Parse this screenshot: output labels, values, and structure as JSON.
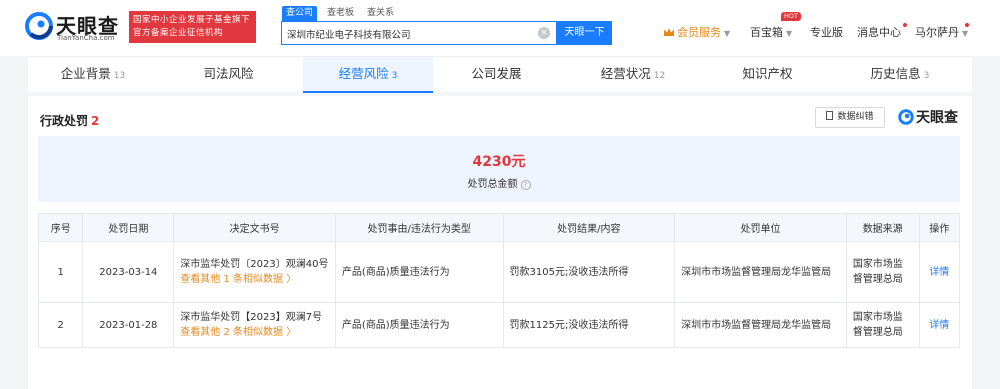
{
  "brand": {
    "logo_text": "天眼查",
    "logo_url": "TianYanCha.com",
    "slogan_line1": "国家中小企业发展子基金旗下",
    "slogan_line2": "官方备案企业征信机构"
  },
  "search": {
    "tabs": [
      "查公司",
      "查老板",
      "查关系"
    ],
    "value": "深圳市纪业电子科技有限公司",
    "button_label": "天眼一下"
  },
  "header_nav": {
    "vip_label": "会员服务",
    "treasure_label": "百宝箱",
    "hot_badge": "HOT",
    "pro_label": "专业版",
    "messages_label": "消息中心",
    "user_name": "马尔萨丹"
  },
  "tabs": [
    {
      "label": "企业背景",
      "count": "13"
    },
    {
      "label": "司法风险",
      "count": ""
    },
    {
      "label": "经营风险",
      "count": "3"
    },
    {
      "label": "公司发展",
      "count": ""
    },
    {
      "label": "经营状况",
      "count": "12"
    },
    {
      "label": "知识产权",
      "count": ""
    },
    {
      "label": "历史信息",
      "count": "3"
    }
  ],
  "section": {
    "title": "行政处罚",
    "count": "2",
    "correct_button": "数据纠错",
    "brand_text": "天眼查"
  },
  "summary": {
    "amount": "4230元",
    "label": "处罚总金额"
  },
  "table": {
    "headers": [
      "序号",
      "处罚日期",
      "决定文书号",
      "处罚事由/违法行为类型",
      "处罚结果/内容",
      "处罚单位",
      "数据来源",
      "操作"
    ],
    "rows": [
      {
        "index": "1",
        "date": "2023-03-14",
        "doc_no": "深市监华处罚〔2023〕观澜40号",
        "more": "查看其他 1 条相似数据 〉",
        "reason": "产品(商品)质量违法行为",
        "result": "罚款3105元;没收违法所得",
        "unit": "深圳市市场监督管理局龙华监管局",
        "source": "国家市场监督管理总局",
        "action": "详情"
      },
      {
        "index": "2",
        "date": "2023-01-28",
        "doc_no": "深市监华处罚【2023】观澜7号",
        "more": "查看其他 2 条相似数据 〉",
        "reason": "产品(商品)质量违法行为",
        "result": "罚款1125元;没收违法所得",
        "unit": "深圳市市场监督管理局龙华监管局",
        "source": "国家市场监督管理总局",
        "action": "详情"
      }
    ]
  }
}
